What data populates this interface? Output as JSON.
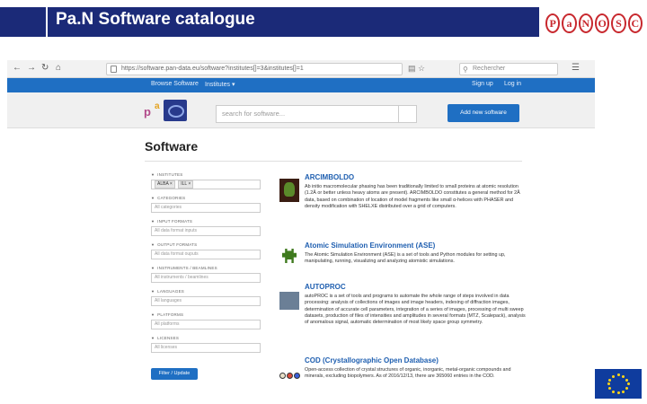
{
  "slide": {
    "title": "Pa.N Software catalogue",
    "logo_letters": [
      "P",
      "a",
      "N",
      "O",
      "S",
      "C"
    ]
  },
  "browser": {
    "url": "https://software.pan-data.eu/software?institutes[]=3&institutes[]=1",
    "search_placeholder": "Rechercher",
    "icons": [
      "back-icon",
      "forward-icon",
      "reload-icon",
      "home-icon",
      "lock-icon",
      "reader-icon",
      "bookmark-star-icon",
      "menu-icon"
    ]
  },
  "site_nav": {
    "browse": "Browse Software",
    "institutes": "Institutes ▾",
    "signup": "Sign up",
    "login": "Log in"
  },
  "header": {
    "search_placeholder": "search for software...",
    "add_button": "Add new software"
  },
  "page": {
    "heading": "Software",
    "filter_button": "Filter / Update"
  },
  "filters": [
    {
      "label": "INSTITUTES",
      "placeholder": "",
      "tags": [
        "ALBA ×",
        "ILL ×"
      ]
    },
    {
      "label": "CATEGORIES",
      "placeholder": "All categories",
      "tags": []
    },
    {
      "label": "INPUT FORMATS",
      "placeholder": "All data format inputs",
      "tags": []
    },
    {
      "label": "OUTPUT FORMATS",
      "placeholder": "All data format ouputs",
      "tags": []
    },
    {
      "label": "INSTRUMENTS / BEAMLINES",
      "placeholder": "All instruments / beamlines",
      "tags": []
    },
    {
      "label": "LANGUAGES",
      "placeholder": "All languages",
      "tags": []
    },
    {
      "label": "PLATFORMS",
      "placeholder": "All platforms",
      "tags": []
    },
    {
      "label": "LICENSES",
      "placeholder": "All licenses",
      "tags": []
    }
  ],
  "results": [
    {
      "name": "ARCIMBOLDO",
      "description": "Ab initio macromolecular phasing has been traditionally limited to small proteins at atomic resolution (1.2Å or better unless heavy atoms are present). ARCIMBOLDO constitutes a general method for 2Å data, based on combination of location of model fragments like small α-helices with PHASER and density modification with SHELXE distributed over a grid of computers."
    },
    {
      "name": "Atomic Simulation Environment (ASE)",
      "description": "The Atomic Simulation Environment (ASE) is a set of tools and Python modules for setting up, manipulating, running, visualizing and analyzing atomistic simulations."
    },
    {
      "name": "AUTOPROC",
      "description": "autoPROC is a set of tools and programs to automate the whole range of steps involved in data processing: analysis of collections of images and image headers, indexing of diffraction images, determination of accurate cell parameters, integration of a series of images, processing of multi sweep datasets, production of files of intensities and amplitudes in several formats (MTZ, Scalepack), analysis of anomalous signal, automatic determination of most likely space group symmetry."
    },
    {
      "name": "COD (Crystallographic Open Database)",
      "description": "Open-access collection of crystal structures of organic, inorganic, metal-organic compounds and minerals, excluding biopolymers. As of 2016/12/13, there are 365060 entries in the COD."
    }
  ],
  "colors": {
    "title_bar": "#1b2a78",
    "nav_blue": "#1f6fc3",
    "link_blue": "#1f5fb0",
    "logo_red": "#c8282e",
    "eu_blue": "#0f3c9e",
    "eu_gold": "#ffd617"
  }
}
